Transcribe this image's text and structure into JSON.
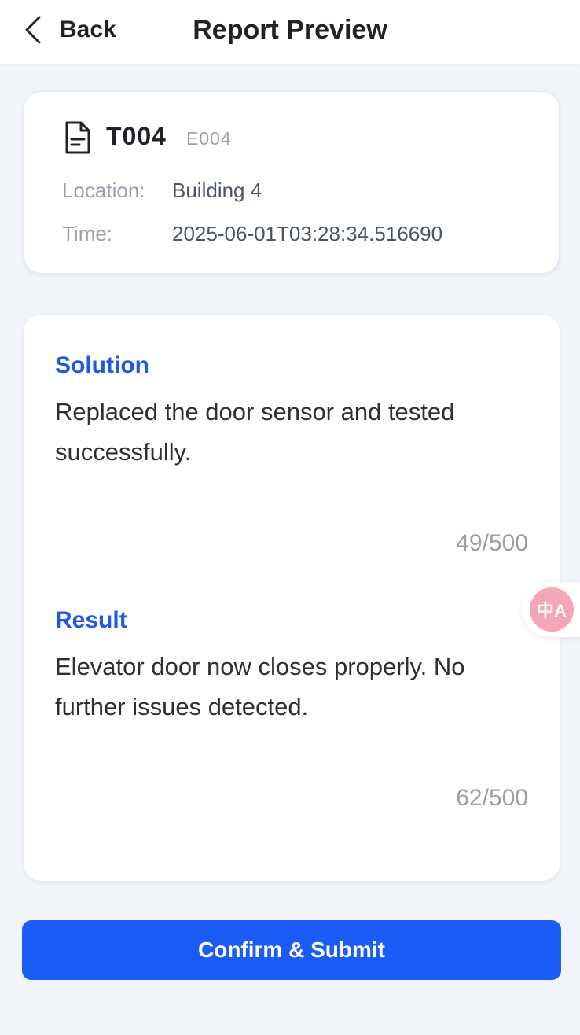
{
  "header": {
    "back_label": "Back",
    "title": "Report Preview",
    "back_icon": "chevron-left-icon"
  },
  "ticket": {
    "icon": "document-icon",
    "id": "T004",
    "equipment_id": "E004",
    "location_label": "Location:",
    "location_value": "Building 4",
    "time_label": "Time:",
    "time_value": "2025-06-01T03:28:34.516690"
  },
  "solution": {
    "title": "Solution",
    "text": "Replaced the door sensor and tested successfully.",
    "counter": "49/500"
  },
  "result": {
    "title": "Result",
    "text": "Elevator door now closes properly. No further issues detected.",
    "counter": "62/500"
  },
  "translate": {
    "icon": "translate-icon",
    "glyph": "中A"
  },
  "actions": {
    "submit_label": "Confirm & Submit"
  },
  "colors": {
    "accent": "#1a5cf5",
    "section_title": "#1f5ae6",
    "background": "#f1f4f9"
  }
}
